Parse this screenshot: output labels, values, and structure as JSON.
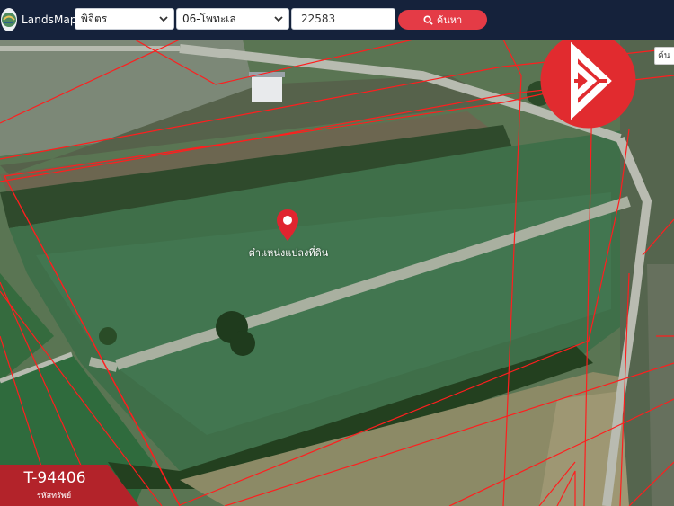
{
  "header": {
    "app_name": "LandsMaps",
    "province": "พิจิตร",
    "district": "06-โพทะเล",
    "parcel_number": "22583",
    "search_label": "ค้นหา"
  },
  "map": {
    "pin_label": "ตำแหน่งแปลงที่ดิน",
    "search_box_text": "ค้น"
  },
  "badge": {
    "code": "T-94406",
    "code_label": "รหัสทรัพย์"
  },
  "colors": {
    "topbar": "#15223b",
    "accent": "#e43b46",
    "boundary": "#ff1e1e",
    "brand": "#e12b2f"
  },
  "icons": [
    "landsmaps-logo-icon",
    "chevron-down-icon",
    "search-icon",
    "map-pin-icon",
    "brand-logo-icon"
  ]
}
